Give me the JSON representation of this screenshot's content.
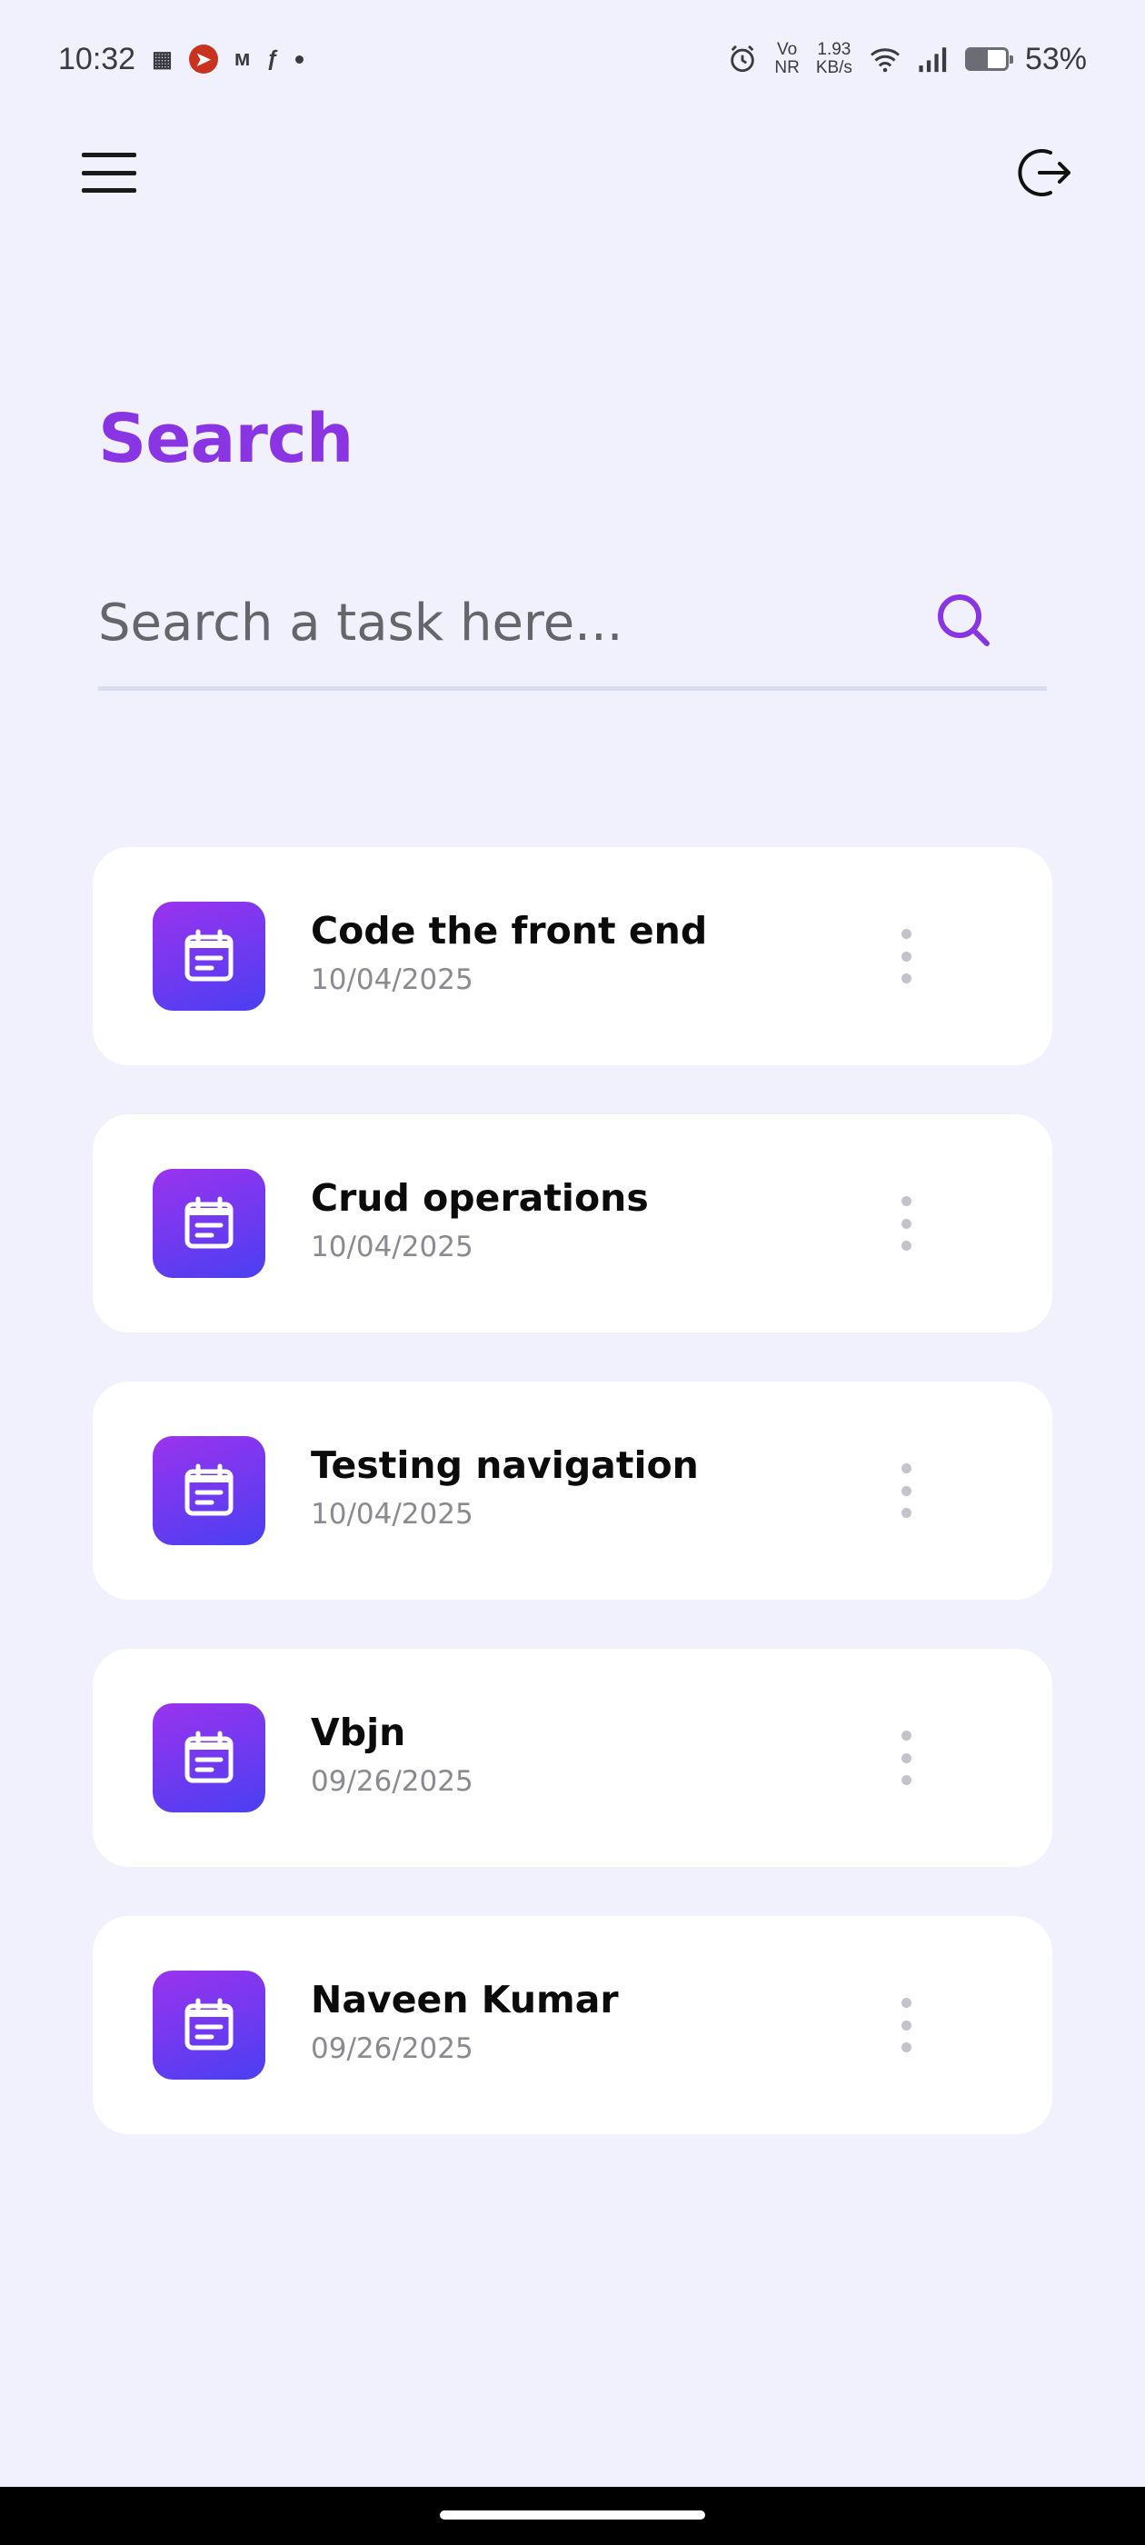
{
  "status_bar": {
    "time": "10:32",
    "network_speed_value": "1.93",
    "network_speed_unit": "KB/s",
    "volte_label": "Vo",
    "volte_sub": "NR",
    "battery_percent": "53%",
    "battery_level": 0.53,
    "notification_icons": [
      "app-notification-icon",
      "rocket-notification-icon",
      "m-notification-icon",
      "flipkart-notification-icon"
    ]
  },
  "header": {
    "menu_icon": "hamburger-menu-icon",
    "logout_icon": "logout-icon"
  },
  "page": {
    "title": "Search"
  },
  "search": {
    "placeholder": "Search a task here...",
    "icon": "search-icon",
    "accent_color": "#8a35e4"
  },
  "tasks": [
    {
      "title": "Code the front end",
      "date": "10/04/2025"
    },
    {
      "title": "Crud operations",
      "date": "10/04/2025"
    },
    {
      "title": "Testing navigation",
      "date": "10/04/2025"
    },
    {
      "title": "Vbjn",
      "date": "09/26/2025"
    },
    {
      "title": "Naveen Kumar",
      "date": "09/26/2025"
    }
  ],
  "colors": {
    "background": "#f0f1fc",
    "title": "#8a35e4",
    "icon_gradient_start": "#9b33ee",
    "icon_gradient_end": "#4a3ff2"
  }
}
